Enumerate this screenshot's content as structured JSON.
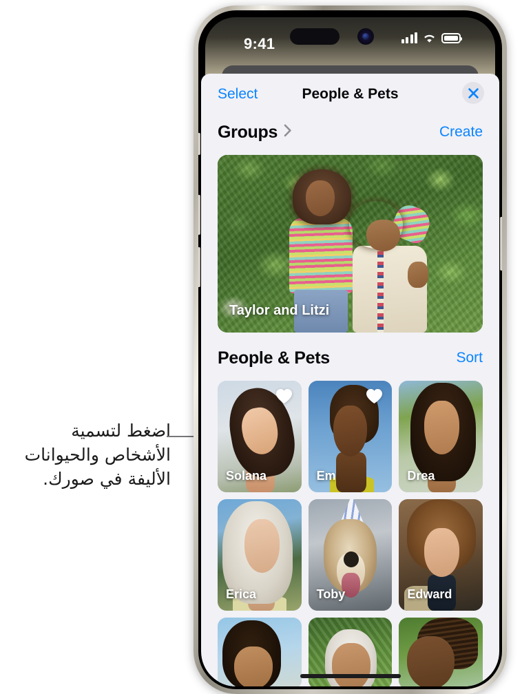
{
  "callout": {
    "text": "اضغط لتسمية الأشخاص والحيوانات الأليفة في صورك."
  },
  "status_bar": {
    "time": "9:41",
    "cellular_icon": "cellular-bars-icon",
    "wifi_icon": "wifi-icon",
    "battery_icon": "battery-full-icon"
  },
  "sheet": {
    "left_action": "Select",
    "title": "People & Pets",
    "close_icon": "close-x-icon"
  },
  "groups_section": {
    "title": "Groups",
    "chevron_icon": "chevron-right-icon",
    "action": "Create",
    "card": {
      "label": "Taylor and Litzi"
    }
  },
  "people_section": {
    "title": "People & Pets",
    "action": "Sort",
    "tiles": [
      {
        "name": "Solana",
        "favorite": true,
        "heart_icon": "heart-filled-icon",
        "cls": "t-solana"
      },
      {
        "name": "Em",
        "favorite": true,
        "heart_icon": "heart-filled-icon",
        "cls": "t-em"
      },
      {
        "name": "Drea",
        "favorite": false,
        "heart_icon": "",
        "cls": "t-drea"
      },
      {
        "name": "Erica",
        "favorite": false,
        "heart_icon": "",
        "cls": "t-erica"
      },
      {
        "name": "Toby",
        "favorite": false,
        "heart_icon": "",
        "cls": "t-toby"
      },
      {
        "name": "Edward",
        "favorite": false,
        "heart_icon": "",
        "cls": "t-edward"
      }
    ],
    "partial_row": [
      {
        "name": "",
        "cls": "t-r3a"
      },
      {
        "name": "",
        "cls": "t-r3b"
      },
      {
        "name": "",
        "cls": "t-r3c"
      }
    ]
  },
  "colors": {
    "accent_blue": "#0a84ff",
    "sheet_bg": "#f1f1f6",
    "close_circle": "#e2e2e8",
    "text_primary": "#09090b",
    "home_indicator": "#1c1c1e"
  }
}
